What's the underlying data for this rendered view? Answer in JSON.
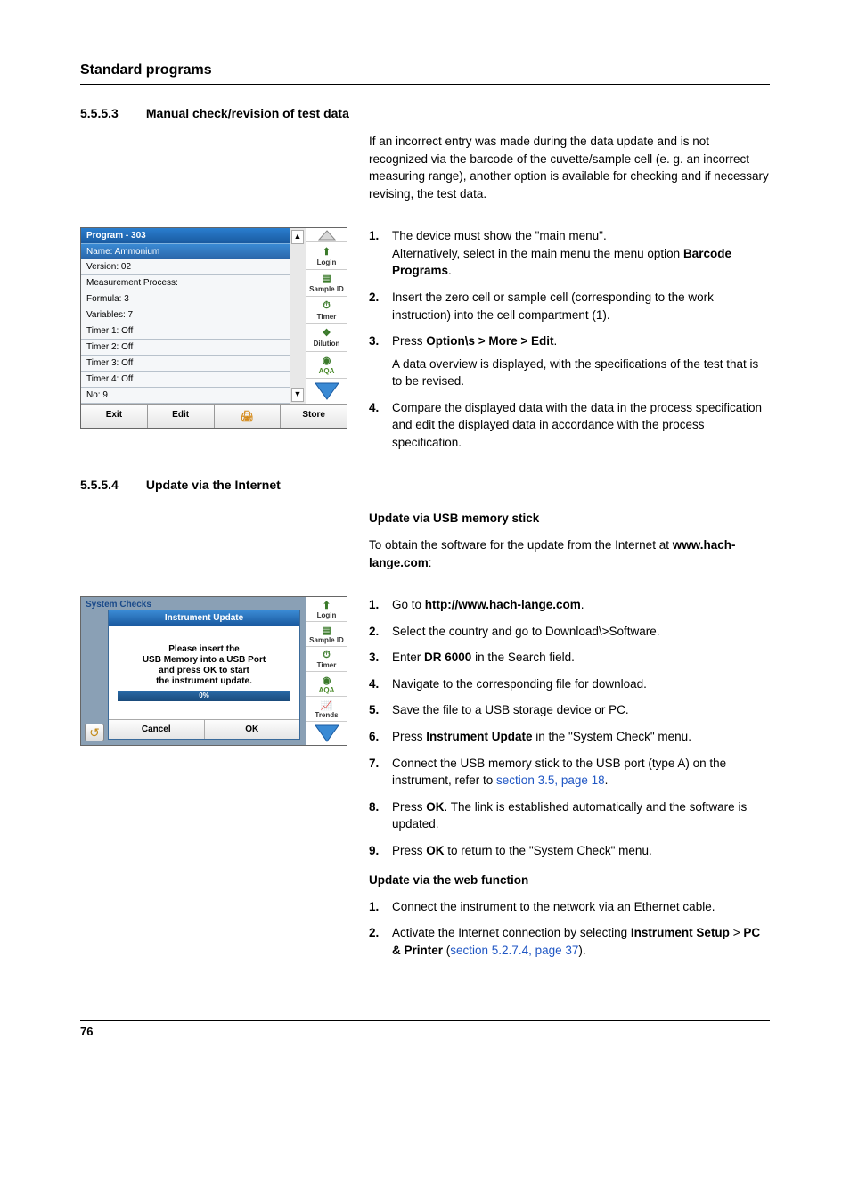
{
  "header": {
    "title": "Standard programs"
  },
  "sec1": {
    "num": "5.5.5.3",
    "title": "Manual check/revision of test data",
    "intro": "If an incorrect entry was made during the data update and is not recognized via the barcode of the cuvette/sample cell (e. g. an incorrect measuring range), another option is available for checking and if necessary revising, the test data.",
    "steps": {
      "s1a": "The device must show the \"main menu\".",
      "s1b": "Alternatively, select in the main menu the menu option ",
      "s1c": "Barcode Programs",
      "s1d": ".",
      "s2": "Insert the zero cell or sample cell (corresponding to the work instruction) into the cell compartment (1).",
      "s3a": "Press ",
      "s3b": "Option\\s > More > Edit",
      "s3c": ".",
      "s3sub": "A data overview is displayed, with the specifications of the test that is to be revised.",
      "s4": "Compare the displayed data with the data in the process specification and edit the displayed data in accordance with the process specification."
    }
  },
  "shot1": {
    "title": "Program - 303",
    "name": "Name: Ammonium",
    "rows": [
      "Version: 02",
      "Measurement Process:",
      "Formula: 3",
      "Variables: 7",
      "Timer 1: Off",
      "Timer 2: Off",
      "Timer 3: Off",
      "Timer 4: Off",
      "No: 9"
    ],
    "arrow_up": "▲",
    "arrow_down": "▼",
    "side": [
      "Login",
      "Sample ID",
      "Timer",
      "Dilution",
      "AQA"
    ],
    "btns": [
      "Exit",
      "Edit",
      "",
      "Store"
    ]
  },
  "sec2": {
    "num": "5.5.5.4",
    "title": "Update via the Internet",
    "sub1": "Update via USB memory stick",
    "sub1_p1": "To obtain the software for the update from the Internet at ",
    "sub1_p2": "www.hach-lange.com",
    "sub1_p3": ":",
    "steps": {
      "s1a": "Go to ",
      "s1b": "http://www.hach-lange.com",
      "s1c": ".",
      "s2": "Select the country and go to Download\\>Software.",
      "s3a": "Enter ",
      "s3b": "DR 6000",
      "s3c": " in the Search field.",
      "s4": "Navigate to the corresponding file for download.",
      "s5": "Save the file to a USB storage device or PC.",
      "s6a": "Press ",
      "s6b": "Instrument Update",
      "s6c": " in the \"System Check\" menu.",
      "s7a": "Connect the USB memory stick to the USB port (type  A) on the instrument, refer to ",
      "s7b": "section 3.5, page 18",
      "s7c": ".",
      "s8a": "Press ",
      "s8b": "OK",
      "s8c": ". The link is established automatically and the software is updated.",
      "s9a": "Press ",
      "s9b": "OK",
      "s9c": " to return to the \"System Check\" menu."
    },
    "sub2": "Update via the web function",
    "steps2": {
      "s1": "Connect the instrument to the network via an Ethernet cable.",
      "s2a": "Activate the Internet connection by selecting ",
      "s2b": "Instrument Setup",
      "s2c": " > ",
      "s2d": "PC & Printer",
      "s2e": " (",
      "s2f": "section 5.2.7.4, page 37",
      "s2g": ")."
    }
  },
  "shot2": {
    "sys": "System Checks",
    "title": "Instrument Update",
    "l1": "Please insert the",
    "l2": "USB Memory into a USB Port",
    "l3": "and press OK to start",
    "l4": "the instrument update.",
    "prog": "0%",
    "btns": [
      "Cancel",
      "OK"
    ],
    "back": "↺",
    "side": [
      "Login",
      "Sample ID",
      "Timer",
      "AQA",
      "Trends"
    ]
  },
  "footer": {
    "page": "76"
  }
}
